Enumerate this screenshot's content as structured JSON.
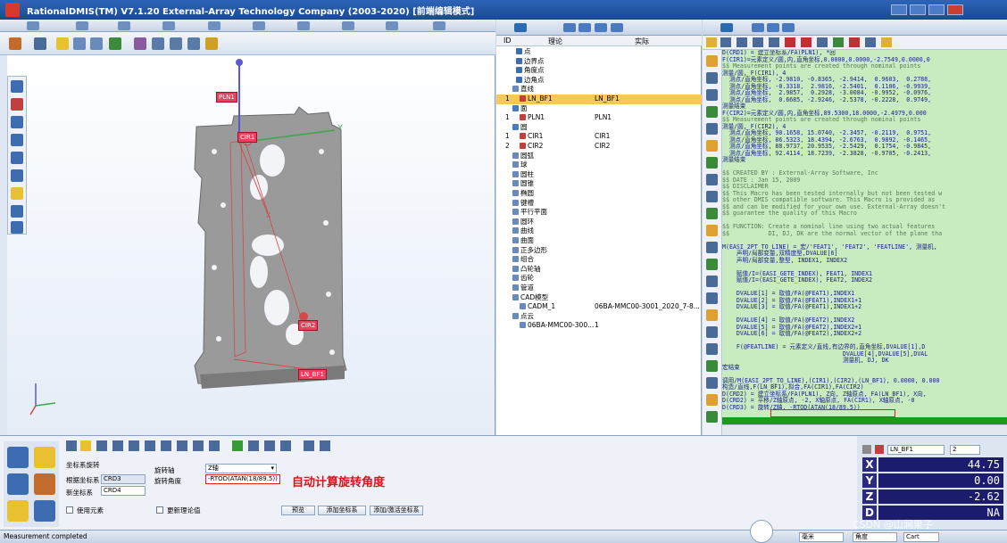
{
  "window": {
    "title": "RationalDMIS(TM) V7.1.20   External-Array Technology Company (2003-2020) [前端编辑模式]"
  },
  "tree": {
    "col_id": "ID",
    "col_theory": "理论",
    "col_actual": "实际",
    "rows": [
      {
        "id": "",
        "name": "点",
        "actual": ""
      },
      {
        "id": "",
        "name": "边界点",
        "actual": ""
      },
      {
        "id": "",
        "name": "角度点",
        "actual": ""
      },
      {
        "id": "",
        "name": "边角点",
        "actual": ""
      },
      {
        "id": "",
        "name": "直线",
        "actual": ""
      },
      {
        "id": "1",
        "name": "LN_BF1",
        "actual": "LN_BF1"
      },
      {
        "id": "",
        "name": "面",
        "actual": ""
      },
      {
        "id": "1",
        "name": "PLN1",
        "actual": "PLN1"
      },
      {
        "id": "",
        "name": "圆",
        "actual": ""
      },
      {
        "id": "1",
        "name": "CIR1",
        "actual": "CIR1"
      },
      {
        "id": "2",
        "name": "CIR2",
        "actual": "CIR2"
      },
      {
        "id": "",
        "name": "圆弧",
        "actual": ""
      },
      {
        "id": "",
        "name": "球",
        "actual": ""
      },
      {
        "id": "",
        "name": "圆柱",
        "actual": ""
      },
      {
        "id": "",
        "name": "圆锥",
        "actual": ""
      },
      {
        "id": "",
        "name": "椭圆",
        "actual": ""
      },
      {
        "id": "",
        "name": "键槽",
        "actual": ""
      },
      {
        "id": "",
        "name": "平行平面",
        "actual": ""
      },
      {
        "id": "",
        "name": "圆环",
        "actual": ""
      },
      {
        "id": "",
        "name": "曲线",
        "actual": ""
      },
      {
        "id": "",
        "name": "曲面",
        "actual": ""
      },
      {
        "id": "",
        "name": "正多边形",
        "actual": ""
      },
      {
        "id": "",
        "name": "组合",
        "actual": ""
      },
      {
        "id": "",
        "name": "凸轮轴",
        "actual": ""
      },
      {
        "id": "",
        "name": "齿轮",
        "actual": ""
      },
      {
        "id": "",
        "name": "管道",
        "actual": ""
      },
      {
        "id": "",
        "name": "CAD模型",
        "actual": ""
      },
      {
        "id": "",
        "name": "CADM_1",
        "actual": "06BA-MMC00-3001_2020_7-8..."
      },
      {
        "id": "",
        "name": "点云",
        "actual": ""
      },
      {
        "id": "",
        "name": "06BA-MMC00-300...",
        "actual": "1"
      }
    ]
  },
  "code": {
    "lines": [
      "D(CRD1) = 建立坐标系/FA(PLN1), *回",
      "F(CIR1)=元素定义/圆,内,直角坐标,0.0000,0.0000,-2.7549,0.0000,0",
      "$$ Measurement points are created through nominal points",
      "测量/圆, F(CIR1), 4",
      "  测点/直角坐标, -2.9810, -0.8365, -2.9414,  0.9603,  0.2788,",
      "  测点/直角坐标, -0.3318,  2.9816, -2.5401,  0.1106, -0.9939,",
      "  测点/直角坐标,  2.9857,  0.2928, -3.0084, -0.9952, -0.0976,",
      "  测点/直角坐标,  0.6685, -2.9246, -2.5378, -0.2228,  0.9749,",
      "测量结束",
      "F(CIR2)=元素定义/圆,内,直角坐标,89.5300,18.0000,-2.4979,0.000",
      "$$ Measurement points are created through nominal points",
      "测量/圆, F(CIR2), 4",
      "  测点/直角坐标, 90.1658, 15.0740, -2.3457, -0.2119,  0.9751,",
      "  测点/直角坐标, 86.5323, 18.4394, -2.6763,  0.9892, -0.1465,",
      "  测点/直角坐标, 88.9737, 20.9535, -2.5429,  0.1754, -0.9845,",
      "  测点/直角坐标, 92.4114, 18.7239, -2.3828, -0.9705, -0.2413,",
      "测量结束",
      "",
      "$$ CREATED BY : External-Array Software, Inc",
      "$$ DATE : Jan 15, 2009",
      "$$ DISCLAIMER",
      "$$ This Macro has been tested internally but not been tested w",
      "$$ other DMIS compatible software. This Macro is provided as",
      "$$ and can be modified for your own use. External-Array doesn't",
      "$$ guarantee the quality of this Macro",
      "",
      "$$ FUNCTION: Create a nominal line using two actual features",
      "$$           DI, DJ, DK are the normal vector of the plane tha",
      "",
      "M(EASI_2PT_TO_LINE) = 宏/'FEAT1', 'FEAT2', 'FEATLINE', 测量机,",
      "    声明/局部变量,双精度型,DVALUE[6]",
      "    声明/局部变量,整型, INDEX1, INDEX2",
      "",
      "    赋值/I=(EASI_GETE_INDEX), FEAT1, INDEX1",
      "    赋值/I=(EASI_GETE_INDEX), FEAT2, INDEX2",
      "",
      "    DVALUE[1] = 取值/FA(@FEAT1),INDEX1",
      "    DVALUE[2] = 取值/FA(@FEAT1),INDEX1+1",
      "    DVALUE[3] = 取值/FA(@FEAT1),INDEX1+2",
      "",
      "    DVALUE[4] = 取值/FA(@FEAT2),INDEX2",
      "    DVALUE[5] = 取值/FA(@FEAT2),INDEX2+1",
      "    DVALUE[6] = 取值/FA(@FEAT2),INDEX2+2",
      "",
      "    F(@FEATLINE) = 元素定义/直线,有边界的,直角坐标,DVALUE[1],D",
      "                                  DVALUE[4],DVALUE[5],DVAL",
      "                                  测量机, DJ, DK",
      "宏结束",
      "",
      "调用/M(EASI_2PT_TO_LINE),(CIR1),(CIR2),(LN_BF1), 0.0000, 0.000",
      "构造/直线,F(LN_BF1),拟合,FA(CIR1),FA(CIR2)",
      "D(CRD2) = 建立坐标系/FA(PLN1), Z向, Z轴原点, FA(LN_BF1), X向,",
      "D(CRD2) = 平移/Z轴原点, -2, X轴原点, FA(CIR1), X轴原点, -0",
      "D(CRD3) = 旋转/Z轴, -RTOD(ATAN(18/89.5))"
    ]
  },
  "viewport": {
    "labels": {
      "pln1": "PLN1",
      "cir1": "CIR1",
      "cir2": "CIR2",
      "ln_bf1": "LN_BF1",
      "axis_y": "Y",
      "axis_x": "X"
    }
  },
  "bottom": {
    "label_coord_rotation": "坐标系旋转",
    "label_ref_coord": "根据坐标系",
    "value_ref_coord": "CRD3",
    "label_new_coord": "新坐标系",
    "value_new_coord": "CRD4",
    "label_rot_axis": "旋转轴",
    "value_rot_axis": "Z轴",
    "label_rot_angle": "旋转角度",
    "value_rot_angle": "-RTOD(ATAN(18/89.5))",
    "chk_use_element": "使用元素",
    "chk_update_theory": "更新理论值",
    "btn_preview": "预览",
    "btn_add_coord": "添加坐标系",
    "btn_add_save_coord": "添加/激活坐标系",
    "annotation": "自动计算旋转角度"
  },
  "coords": {
    "feature": "LN_BF1",
    "count": "2",
    "x_label": "X",
    "x_value": "44.75",
    "y_label": "Y",
    "y_value": "0.00",
    "z_label": "Z",
    "z_value": "-2.62",
    "d_label": "D",
    "d_value": "NA"
  },
  "status": {
    "text": "Measurement completed",
    "units": "毫米",
    "angle": "角度",
    "coord_type": "Cart"
  },
  "watermark": "CSDN @山涧果子"
}
